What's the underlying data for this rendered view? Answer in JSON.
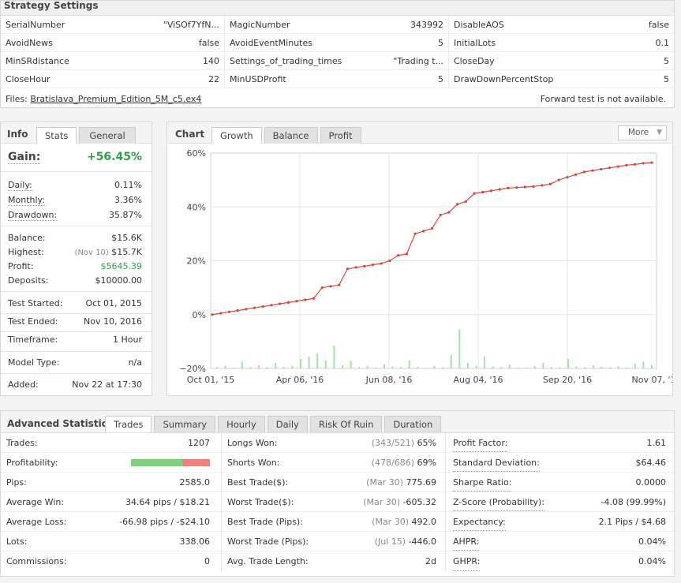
{
  "settings": {
    "title": "Strategy Settings",
    "rows": [
      [
        {
          "k": "SerialNumber",
          "v": "\"ViSOf7YfN..."
        },
        {
          "k": "MagicNumber",
          "v": "343992"
        },
        {
          "k": "DisableAOS",
          "v": "false"
        }
      ],
      [
        {
          "k": "AvoidNews",
          "v": "false"
        },
        {
          "k": "AvoidEventMinutes",
          "v": "5"
        },
        {
          "k": "InitialLots",
          "v": "0.1"
        }
      ],
      [
        {
          "k": "MinSRdistance",
          "v": "140"
        },
        {
          "k": "Settings_of_trading_times",
          "v": "\"Trading t..."
        },
        {
          "k": "CloseDay",
          "v": "5"
        }
      ],
      [
        {
          "k": "CloseHour",
          "v": "22"
        },
        {
          "k": "MinUSDProfit",
          "v": "5"
        },
        {
          "k": "DrawDownPercentStop",
          "v": "5"
        }
      ]
    ],
    "files_label": "Files:",
    "file_name": "Bratislava_Premium_Edition_5M_c5.ex4",
    "forward_note": "Forward test is not available."
  },
  "info": {
    "title": "Info",
    "tabs": [
      "Stats",
      "General"
    ],
    "gain_label": "Gain:",
    "gain_value": "+56.45%",
    "daily_label": "Daily:",
    "daily": "0.11%",
    "monthly_label": "Monthly:",
    "monthly": "3.36%",
    "drawdown_label": "Drawdown:",
    "drawdown": "35.87%",
    "balance_label": "Balance:",
    "balance": "$15.6K",
    "highest_label": "Highest:",
    "highest_date": "(Nov 10)",
    "highest": "$15.7K",
    "profit_label": "Profit:",
    "profit": "$5645.39",
    "deposits_label": "Deposits:",
    "deposits": "$10000.00",
    "started_label": "Test Started:",
    "started": "Oct 01, 2015",
    "ended_label": "Test Ended:",
    "ended": "Nov 10, 2016",
    "timeframe_label": "Timeframe:",
    "timeframe": "1 Hour",
    "model_label": "Model Type:",
    "model": "n/a",
    "added_label": "Added:",
    "added": "Nov 22 at 17:30"
  },
  "chart": {
    "title": "Chart",
    "tabs": [
      "Growth",
      "Balance",
      "Profit"
    ],
    "more_label": "More",
    "colors": {
      "line": "#d8453a",
      "bars": "#a6e0a6",
      "grid": "#e6e6e6"
    }
  },
  "chart_data": {
    "type": "line",
    "y_ticks": [
      "60%",
      "40%",
      "20%",
      "0%",
      "−20%"
    ],
    "ylim": [
      -20,
      60
    ],
    "x_ticks": [
      "Oct 01, '15",
      "Apr 06, '16",
      "Jun 08, '16",
      "Aug 04, '16",
      "Sep 20, '16",
      "Nov 07, '16"
    ],
    "series": [
      {
        "values": [
          0,
          0.5,
          1,
          1.5,
          2,
          2.5,
          3,
          3.5,
          4,
          4.5,
          5,
          5.5,
          6,
          10,
          10.5,
          11,
          17,
          17.5,
          18,
          18.5,
          19,
          20,
          22,
          22.5,
          30,
          31,
          32,
          37,
          38,
          41,
          42,
          45,
          45.5,
          46,
          46.5,
          47,
          47.2,
          47.4,
          47.6,
          48,
          48.5,
          50,
          51,
          52,
          53,
          53.5,
          54,
          54.5,
          55,
          55.5,
          55.8,
          56.2,
          56.45
        ]
      },
      {
        "values": [
          0.5,
          1,
          0.3,
          2.5,
          0.5,
          1.2,
          0.4,
          2,
          0.6,
          1,
          3.5,
          4.5,
          5.5,
          3,
          8.5,
          1.2,
          2.8,
          0.5,
          1,
          0.3,
          1.5,
          0.8,
          0.5,
          3,
          0.6,
          0.2,
          1,
          0.4,
          5,
          14.5,
          2,
          1,
          4.5,
          0.8,
          0.5,
          1.5,
          0.4,
          0.3,
          0.9,
          2,
          0.5,
          0.4,
          3.5,
          0.7,
          0.5,
          1.2,
          0.6,
          0.4,
          0.8,
          0.3,
          1.8,
          2.5,
          1.2
        ]
      }
    ]
  },
  "advanced": {
    "title": "Advanced Statistics",
    "tabs": [
      "Trades",
      "Summary",
      "Hourly",
      "Daily",
      "Risk Of Ruin",
      "Duration"
    ],
    "profitability": 0.65,
    "col1": [
      {
        "k": "Trades:",
        "v": "1207"
      },
      {
        "k": "Profitability:",
        "v": ""
      },
      {
        "k": "Pips:",
        "v": "2585.0"
      },
      {
        "k": "Average Win:",
        "v": "34.64 pips / $18.21"
      },
      {
        "k": "Average Loss:",
        "v": "-66.98 pips / -$24.10"
      },
      {
        "k": "Lots:",
        "v": "338.06"
      },
      {
        "k": "Commissions:",
        "v": "0"
      }
    ],
    "col2": [
      {
        "k": "Longs Won:",
        "m": "(343/521)",
        "v": "65%"
      },
      {
        "k": "Shorts Won:",
        "m": "(478/686)",
        "v": "69%"
      },
      {
        "k": "Best Trade($):",
        "m": "(Mar 30)",
        "v": "775.69"
      },
      {
        "k": "Worst Trade($):",
        "m": "(Mar 30)",
        "v": "-605.32"
      },
      {
        "k": "Best Trade (Pips):",
        "m": "(Mar 30)",
        "v": "492.0"
      },
      {
        "k": "Worst Trade (Pips):",
        "m": "(Jul 15)",
        "v": "-446.0"
      },
      {
        "k": "Avg. Trade Length:",
        "m": "",
        "v": "2d"
      }
    ],
    "col3": [
      {
        "k": "Profit Factor:",
        "v": "1.61"
      },
      {
        "k": "Standard Deviation:",
        "v": "$64.46"
      },
      {
        "k": "Sharpe Ratio:",
        "v": "0.0000"
      },
      {
        "k": "Z-Score (Probability):",
        "v": "-4.08 (99.99%)"
      },
      {
        "k": "Expectancy:",
        "v": "2.1 Pips / $4.68"
      },
      {
        "k": "AHPR:",
        "v": "0.04%"
      },
      {
        "k": "GHPR:",
        "v": "0.04%"
      }
    ]
  }
}
